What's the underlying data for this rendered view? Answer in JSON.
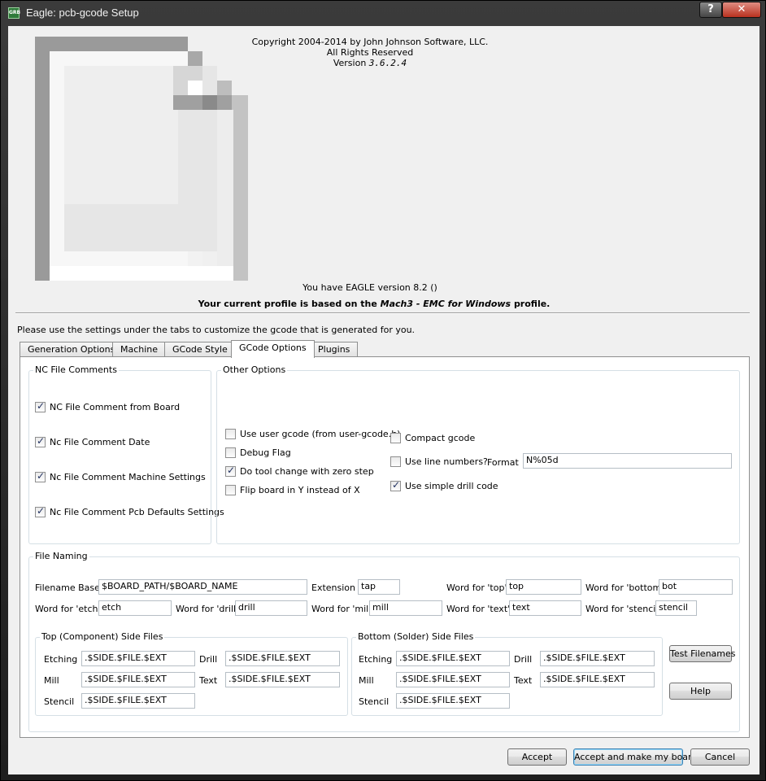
{
  "window": {
    "title": "Eagle: pcb-gcode Setup",
    "app_icon_text": "GRB",
    "help_label": "?",
    "close_label": "✕"
  },
  "about": {
    "copyright": "Copyright 2004-2014 by John Johnson Software, LLC.",
    "rights": "All Rights Reserved",
    "version_label": "Version",
    "version": "3.6.2.4",
    "eagle_version": "You have EAGLE version 8.2 ()",
    "profile_prefix": "Your current profile is based on the",
    "profile_name": "Mach3 - EMC for Windows",
    "profile_suffix": "profile."
  },
  "instructions": "Please use the settings under the tabs to customize the gcode that is generated for you.",
  "tabs": [
    {
      "label": "Generation Options"
    },
    {
      "label": "Machine"
    },
    {
      "label": "GCode Style"
    },
    {
      "label": "GCode Options",
      "active": true
    },
    {
      "label": "Plugins"
    }
  ],
  "nc_comments": {
    "title": "NC File Comments",
    "items": [
      {
        "label": "NC File Comment from Board",
        "checked": true
      },
      {
        "label": "Nc File Comment Date",
        "checked": true
      },
      {
        "label": "Nc File Comment Machine Settings",
        "checked": true
      },
      {
        "label": "Nc File Comment Pcb Defaults Settings",
        "checked": true
      }
    ]
  },
  "other_options": {
    "title": "Other Options",
    "use_user_gcode": {
      "label": "Use user gcode (from user-gcode.h)",
      "checked": false
    },
    "debug_flag": {
      "label": "Debug Flag",
      "checked": false
    },
    "tool_change": {
      "label": "Do tool change with zero step",
      "checked": true
    },
    "flip_board": {
      "label": "Flip board in Y instead of X",
      "checked": false
    },
    "compact_gcode": {
      "label": "Compact gcode",
      "checked": false
    },
    "line_numbers": {
      "label": "Use line numbers?",
      "checked": false
    },
    "format_label": "Format",
    "format_value": "N%05d",
    "simple_drill": {
      "label": "Use simple drill code",
      "checked": true
    }
  },
  "file_naming": {
    "title": "File Naming",
    "filename_base_label": "Filename Base",
    "filename_base": "$BOARD_PATH/$BOARD_NAME",
    "extension_label": "Extension",
    "extension": "tap",
    "top_label": "Word for 'top'",
    "top": "top",
    "bottom_label": "Word for 'bottom'",
    "bottom": "bot",
    "etch_label": "Word for 'etch'",
    "etch": "etch",
    "drill_label": "Word for 'drill'",
    "drill": "drill",
    "mill_label": "Word for 'mill'",
    "mill": "mill",
    "text_label": "Word for 'text'",
    "text": "text",
    "stencil_label": "Word for 'stencil'",
    "stencil": "stencil",
    "top_files": {
      "title": "Top (Component) Side Files",
      "etching_label": "Etching",
      "etching": ".$SIDE.$FILE.$EXT",
      "drill_label": "Drill",
      "drill": ".$SIDE.$FILE.$EXT",
      "mill_label": "Mill",
      "mill": ".$SIDE.$FILE.$EXT",
      "text_label": "Text",
      "text": ".$SIDE.$FILE.$EXT",
      "stencil_label": "Stencil",
      "stencil": ".$SIDE.$FILE.$EXT"
    },
    "bottom_files": {
      "title": "Bottom (Solder) Side Files",
      "etching_label": "Etching",
      "etching": ".$SIDE.$FILE.$EXT",
      "drill_label": "Drill",
      "drill": ".$SIDE.$FILE.$EXT",
      "mill_label": "Mill",
      "mill": ".$SIDE.$FILE.$EXT",
      "text_label": "Text",
      "text": ".$SIDE.$FILE.$EXT",
      "stencil_label": "Stencil",
      "stencil": ".$SIDE.$FILE.$EXT"
    },
    "test_filenames": "Test Filenames",
    "help": "Help"
  },
  "buttons": {
    "accept": "Accept",
    "accept_make": "Accept and make my board",
    "cancel": "Cancel"
  }
}
